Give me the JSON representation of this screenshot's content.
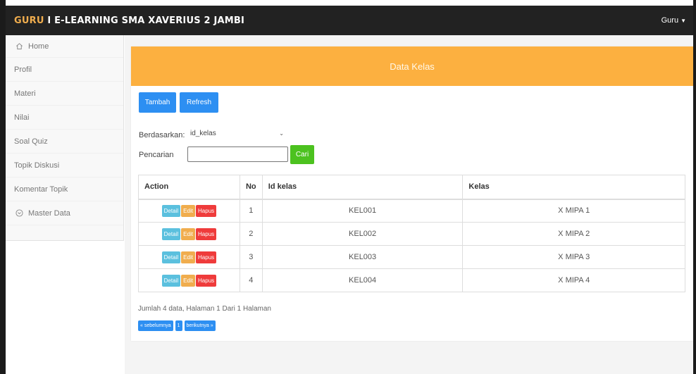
{
  "navbar": {
    "brand_accent": "GURU",
    "brand_rest": " I E-LEARNING SMA XAVERIUS 2 JAMBI",
    "user_menu": "Guru",
    "caret_icon": "caret-down-icon"
  },
  "sidebar": {
    "items": [
      {
        "label": "Home",
        "icon": "home-icon"
      },
      {
        "label": "Profil"
      },
      {
        "label": "Materi"
      },
      {
        "label": "Nilai"
      },
      {
        "label": "Soal Quiz"
      },
      {
        "label": "Topik Diskusi"
      },
      {
        "label": "Komentar Topik"
      },
      {
        "label": "Master Data",
        "icon": "circle-chevron-down-icon"
      }
    ]
  },
  "panel": {
    "title": "Data Kelas",
    "buttons": {
      "add": "Tambah",
      "refresh": "Refresh"
    },
    "filter": {
      "by_label": "Berdasarkan:",
      "by_value": "id_kelas",
      "search_label": "Pencarian",
      "search_value": "",
      "search_button": "Cari"
    }
  },
  "table": {
    "headers": {
      "action": "Action",
      "no": "No",
      "id": "Id kelas",
      "kelas": "Kelas"
    },
    "action_labels": {
      "detail": "Detail",
      "edit": "Edit",
      "hapus": "Hapus"
    },
    "rows": [
      {
        "no": "1",
        "id": "KEL001",
        "kelas": "X MIPA 1"
      },
      {
        "no": "2",
        "id": "KEL002",
        "kelas": "X MIPA 2"
      },
      {
        "no": "3",
        "id": "KEL003",
        "kelas": "X MIPA 3"
      },
      {
        "no": "4",
        "id": "KEL004",
        "kelas": "X MIPA 4"
      }
    ]
  },
  "footer": {
    "summary": "Jumlah 4 data, Halaman 1 Dari 1 Halaman",
    "pager": {
      "prev": "« sebelumnya",
      "page": "1",
      "next": "berikutnya »"
    }
  },
  "colors": {
    "navbar": "#222222",
    "brand_accent": "#f0ad4e",
    "panel_header": "#fcb040",
    "primary_button": "#2d8ff2",
    "search_button": "#4cc21f",
    "detail": "#5bc0de",
    "edit": "#f0ad4e",
    "hapus": "#ef3b3b"
  }
}
